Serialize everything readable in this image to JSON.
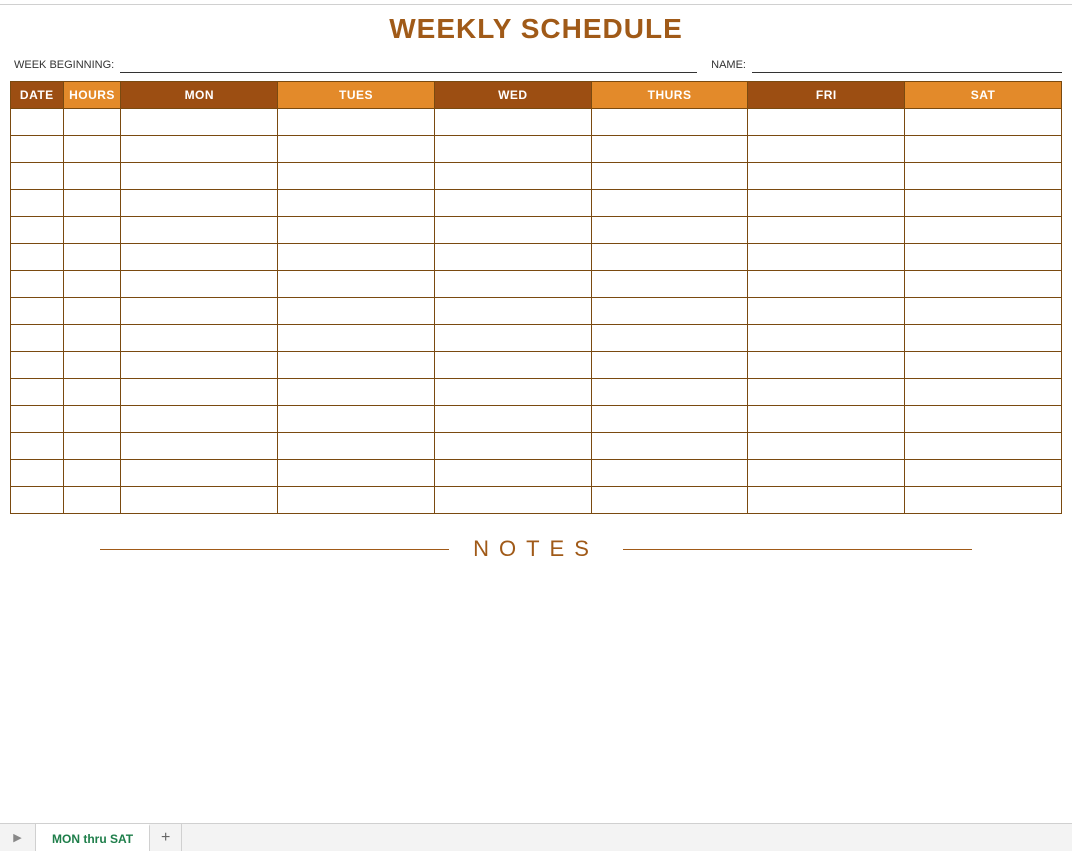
{
  "title": "WEEKLY SCHEDULE",
  "meta": {
    "week_label": "WEEK BEGINNING:",
    "name_label": "NAME:",
    "week_value": "",
    "name_value": ""
  },
  "headers": {
    "date": "DATE",
    "hours": "HOURS",
    "mon": "MON",
    "tues": "TUES",
    "wed": "WED",
    "thurs": "THURS",
    "fri": "FRI",
    "sat": "SAT"
  },
  "rows_count": 15,
  "notes_label": "NOTES",
  "tabs": {
    "active": "MON thru SAT",
    "add": "+"
  }
}
